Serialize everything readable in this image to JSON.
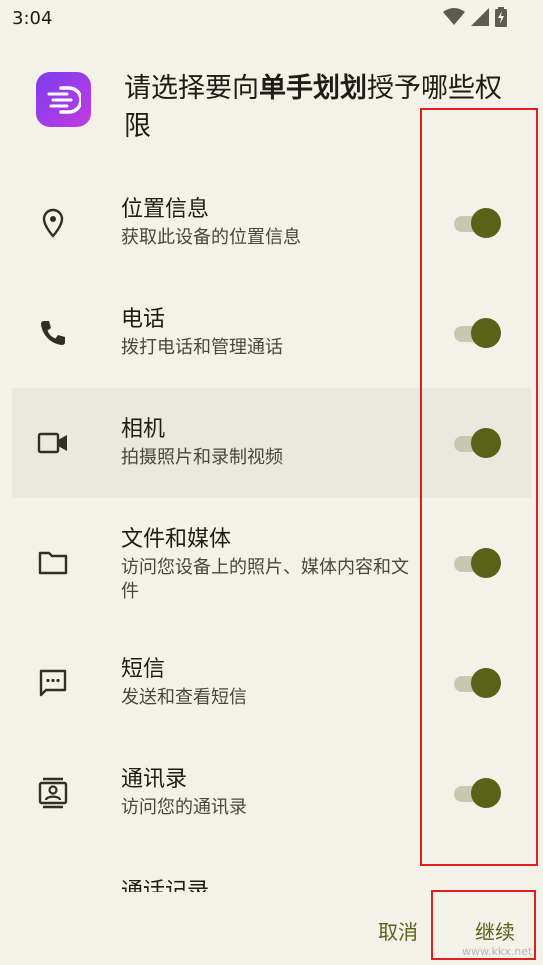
{
  "status_bar": {
    "time": "3:04"
  },
  "header": {
    "title_prefix": "请选择要向",
    "app_name": "单手划划",
    "title_suffix": "授予哪些权限"
  },
  "permissions": [
    {
      "title": "位置信息",
      "desc": "获取此设备的位置信息",
      "icon": "location-pin-icon",
      "enabled": true
    },
    {
      "title": "电话",
      "desc": "拨打电话和管理通话",
      "icon": "phone-icon",
      "enabled": true
    },
    {
      "title": "相机",
      "desc": "拍摄照片和录制视频",
      "icon": "video-camera-icon",
      "enabled": true
    },
    {
      "title": "文件和媒体",
      "desc": "访问您设备上的照片、媒体内容和文件",
      "icon": "folder-icon",
      "enabled": true
    },
    {
      "title": "短信",
      "desc": "发送和查看短信",
      "icon": "message-icon",
      "enabled": true
    },
    {
      "title": "通讯录",
      "desc": "访问您的通讯录",
      "icon": "contacts-icon",
      "enabled": true
    }
  ],
  "partial_item": {
    "title": "通话记录"
  },
  "buttons": {
    "cancel": "取消",
    "continue": "继续"
  },
  "watermark": "www.kkx.net",
  "colors": {
    "background": "#f4f1e8",
    "toggle_thumb": "#5a6118",
    "toggle_track": "#c8c8b0",
    "accent_text": "#5a6118",
    "annotation": "#e02020"
  }
}
